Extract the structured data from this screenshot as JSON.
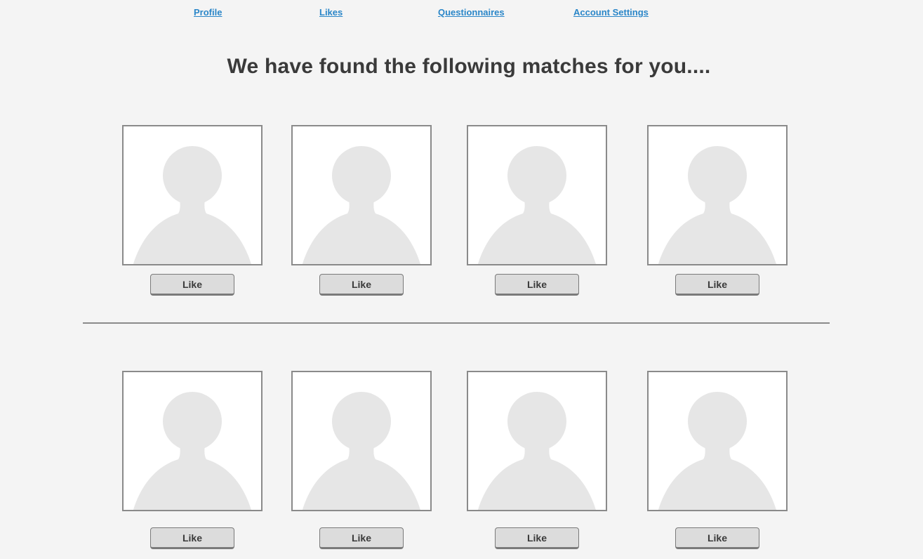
{
  "nav": {
    "items": [
      {
        "label": "Profile"
      },
      {
        "label": "Likes"
      },
      {
        "label": "Questionnaires"
      },
      {
        "label": "Account Settings"
      }
    ]
  },
  "page_title": "We have found the following matches for you....",
  "matches": {
    "row1": [
      {
        "photo_icon": "avatar-placeholder-icon",
        "like_label": "Like"
      },
      {
        "photo_icon": "avatar-placeholder-icon",
        "like_label": "Like"
      },
      {
        "photo_icon": "avatar-placeholder-icon",
        "like_label": "Like"
      },
      {
        "photo_icon": "avatar-placeholder-icon",
        "like_label": "Like"
      }
    ],
    "row2": [
      {
        "photo_icon": "avatar-placeholder-icon",
        "like_label": "Like"
      },
      {
        "photo_icon": "avatar-placeholder-icon",
        "like_label": "Like"
      },
      {
        "photo_icon": "avatar-placeholder-icon",
        "like_label": "Like"
      },
      {
        "photo_icon": "avatar-placeholder-icon",
        "like_label": "Like"
      }
    ]
  },
  "colors": {
    "background": "#f4f4f4",
    "link": "#2a86c8",
    "avatar_fill": "#e6e6e6",
    "border": "#8a8a8a",
    "button": "#dcdcdc"
  }
}
